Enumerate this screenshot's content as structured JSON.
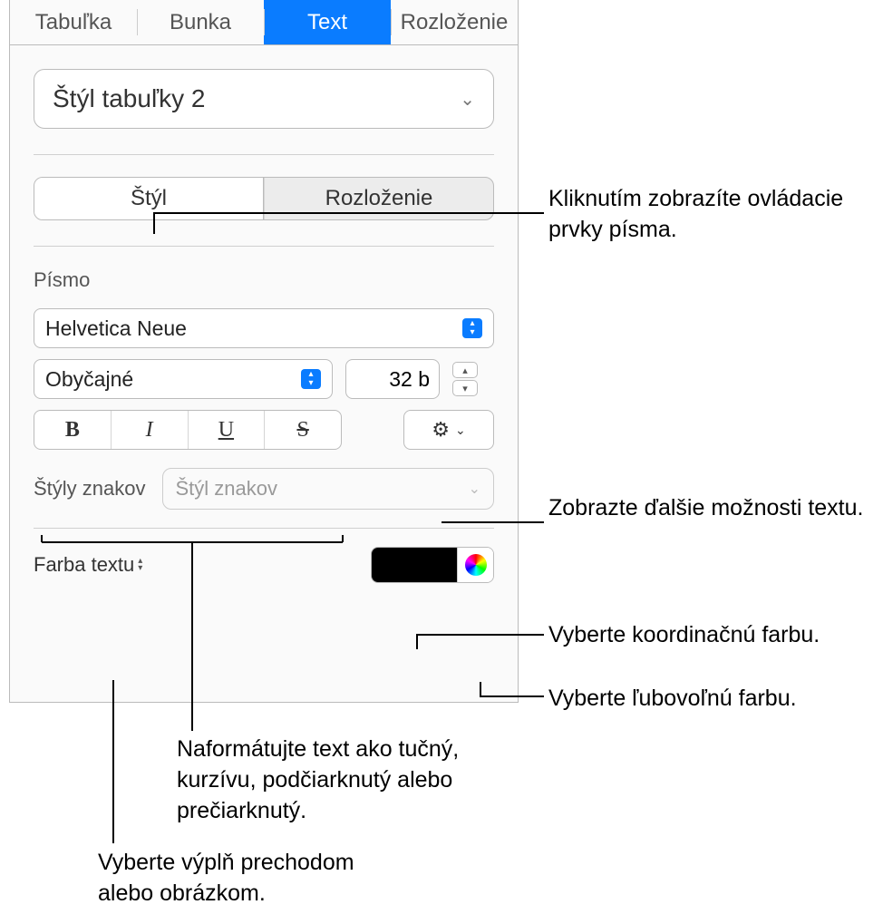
{
  "tabs": {
    "t0": "Tabuľka",
    "t1": "Bunka",
    "t2": "Text",
    "t3": "Rozloženie"
  },
  "styleSelect": "Štýl tabuľky 2",
  "seg": {
    "style": "Štýl",
    "layout": "Rozloženie"
  },
  "font": {
    "section": "Písmo",
    "family": "Helvetica Neue",
    "weight": "Obyčajné",
    "size": "32 b"
  },
  "bius": {
    "b": "B",
    "i": "I",
    "u": "U",
    "s": "S"
  },
  "charStyles": {
    "label": "Štýly znakov",
    "placeholder": "Štýl znakov"
  },
  "textColor": {
    "label": "Farba textu"
  },
  "callouts": {
    "c1": "Kliknutím zobrazíte ovládacie prvky písma.",
    "c2": "Zobrazte ďalšie možnosti textu.",
    "c3": "Vyberte koordinačnú farbu.",
    "c4": "Vyberte ľubovoľnú farbu.",
    "c5": "Naformátujte text ako tučný, kurzívu, podčiarknutý alebo prečiarknutý.",
    "c6": "Vyberte výplň prechodom alebo obrázkom."
  }
}
